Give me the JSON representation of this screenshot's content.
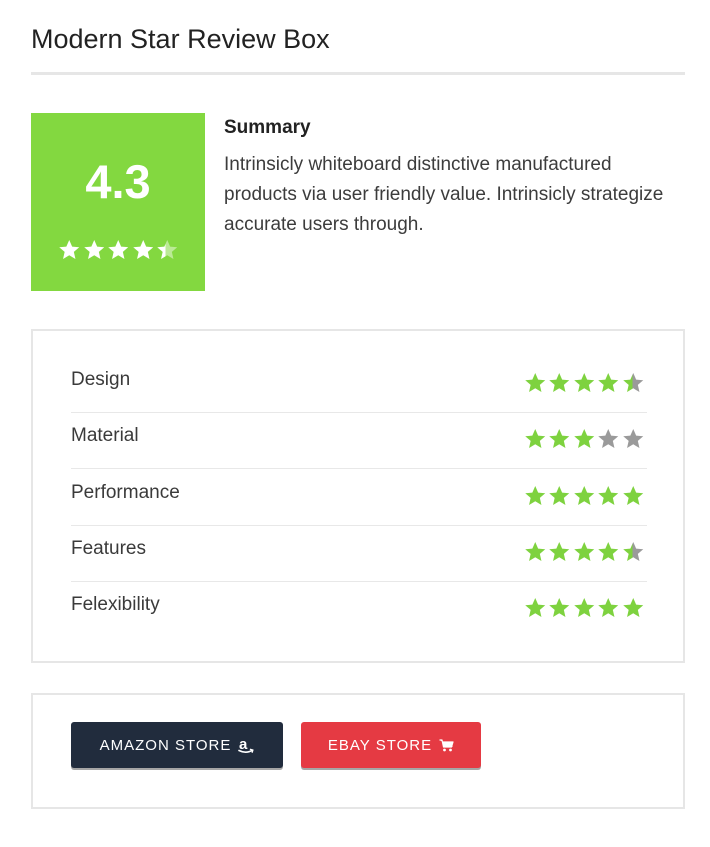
{
  "page": {
    "title": "Modern Star Review Box"
  },
  "score": {
    "value": "4.3",
    "stars": 4.3,
    "box_color": "#83d840",
    "star_color": "#ffffff"
  },
  "summary": {
    "heading": "Summary",
    "text": "Intrinsicly whiteboard distinctive manufactured products via user friendly value. Intrinsicly strategize accurate users through."
  },
  "criteria": [
    {
      "label": "Design",
      "rating": 4.5
    },
    {
      "label": "Material",
      "rating": 3
    },
    {
      "label": "Performance",
      "rating": 5
    },
    {
      "label": "Features",
      "rating": 4.5
    },
    {
      "label": "Felexibility",
      "rating": 5
    }
  ],
  "stars_max": 5,
  "colors": {
    "star_filled": "#7ed23f",
    "star_empty": "#9a9a9a",
    "amazon_button": "#212c3d",
    "ebay_button": "#e53a43"
  },
  "stores": {
    "amazon_label": "AMAZON STORE",
    "amazon_icon": "amazon-icon",
    "ebay_label": "EBAY STORE",
    "ebay_icon": "cart-icon"
  }
}
